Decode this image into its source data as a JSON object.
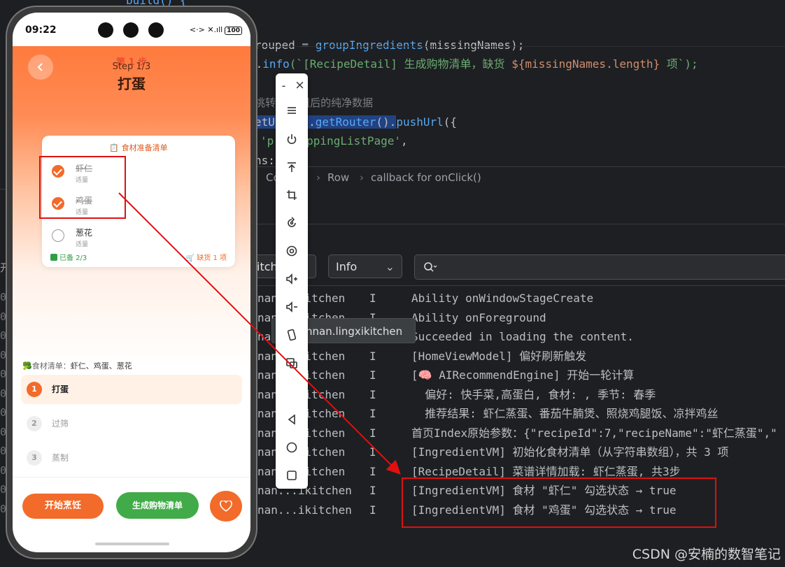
{
  "ide": {
    "code": {
      "line0": "build() {",
      "line1_prefix": "rouped = ",
      "line1_fn": "groupIngredients",
      "line1_rest": "(missingNames);",
      "line2_a": "e.",
      "line2_fn": "info",
      "line2_str": "(`[RecipeDetail] 生成购物清单，缺货 ",
      "line2_expr": "${missingNames.length}",
      "line2_tail": " 项`);",
      "line3": "挑转    分组后的纯净数据",
      "line4_a": "etU",
      "line4_b": "ext().",
      "line4_fn1": "getRouter",
      "line4_c": "().",
      "line4_fn2": "pushUrl",
      "line4_d": "({",
      "line5_a": "'p",
      "line5_str": "ShoppingListPage'",
      "line5_b": ",",
      "line6": "ns:"
    },
    "breadcrumb": {
      "item1": "Co",
      "item2": "Row",
      "item3": "callback for onClick()"
    },
    "log_toolbar": {
      "filter_partial": "itch",
      "level": "Info",
      "search_placeholder": ""
    },
    "left_gutter": {
      "tab_char": "开",
      "row_char": "0"
    },
    "logs": [
      {
        "tag": "nan...kitchen",
        "level": "I",
        "msg": "Ability onWindowStageCreate"
      },
      {
        "tag": "nan...kitchen",
        "level": "I",
        "msg": "Ability onForeground"
      },
      {
        "tag": "nan...kitchen",
        "level": "I",
        "msg": "Succeeded in loading the content."
      },
      {
        "tag": "nan...kitchen",
        "level": "I",
        "msg": "[HomeViewModel] 偏好刷新触发"
      },
      {
        "tag": "nan...kitchen",
        "level": "I",
        "msg": "[🧠 AIRecommendEngine] 开始一轮计算"
      },
      {
        "tag": "nan...kitchen",
        "level": "I",
        "msg": "  偏好: 快手菜,高蛋白, 食材: , 季节: 春季"
      },
      {
        "tag": "nan...kitchen",
        "level": "I",
        "msg": "  推荐结果: 虾仁蒸蛋、番茄牛腩煲、照烧鸡腿饭、凉拌鸡丝"
      },
      {
        "tag": "nan...kitchen",
        "level": "I",
        "msg": "首页Index原始参数：{\"recipeId\":7,\"recipeName\":\"虾仁蒸蛋\",\""
      },
      {
        "tag": "nan...kitchen",
        "level": "I",
        "msg": "[IngredientVM] 初始化食材清单（从字符串数组），共 3 项"
      },
      {
        "tag": "nan...kitchen",
        "level": "I",
        "msg": "[RecipeDetail] 菜谱详情加载: 虾仁蒸蛋, 共3步"
      },
      {
        "tag": "nan...ikitchen",
        "level": "I",
        "msg": "[IngredientVM] 食材 \"虾仁\" 勾选状态 → true"
      },
      {
        "tag": "nan...ikitchen",
        "level": "I",
        "msg": "[IngredientVM] 食材 \"鸡蛋\" 勾选状态 → true"
      }
    ],
    "tooltip": "nnan.lingxikitchen",
    "watermark": "CSDN @安楠的数智笔记"
  },
  "emulator_toolbar": {
    "minimize_label": "-",
    "close_label": "×",
    "icons": [
      "menu-icon",
      "power-icon",
      "pin-top-icon",
      "crop-icon",
      "rotate-icon",
      "screenshot-icon",
      "volume-up-icon",
      "volume-down-icon",
      "fold-icon",
      "multi-window-icon",
      "back-icon",
      "home-icon",
      "recents-icon"
    ]
  },
  "phone": {
    "status": {
      "time": "09:22",
      "network": "<·> ✕.ıll",
      "battery": "100"
    },
    "step_ghost": "第 1 步",
    "step_label": "Step 1/3",
    "step_title": "打蛋",
    "card": {
      "title": "📋 食材准备清单",
      "ingredients": [
        {
          "name": "虾仁",
          "qty": "适量",
          "checked": true
        },
        {
          "name": "鸡蛋",
          "qty": "适量",
          "checked": true
        },
        {
          "name": "葱花",
          "qty": "适量",
          "checked": false
        }
      ],
      "ready": "已备 2/3",
      "missing": "🛒 缺货 1 项"
    },
    "ingredient_summary": {
      "icon": "🥦",
      "label": "食材清单：",
      "value": "虾仁、鸡蛋、葱花"
    },
    "steps": [
      {
        "num": "1",
        "name": "打蛋"
      },
      {
        "num": "2",
        "name": "过筛"
      },
      {
        "num": "3",
        "name": "蒸制"
      }
    ],
    "buttons": {
      "cook": "开始烹饪",
      "shopping": "生成购物清单"
    },
    "accent": "#f26b2a",
    "green": "#42ab49"
  }
}
